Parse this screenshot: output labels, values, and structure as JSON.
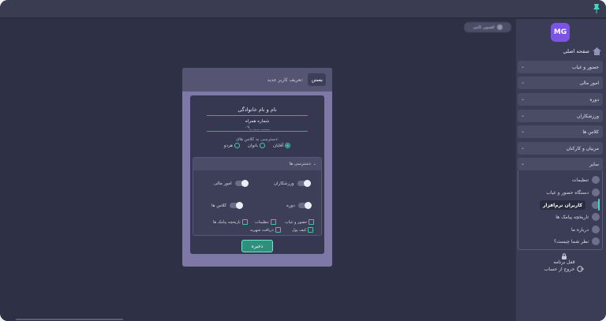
{
  "user_chip": {
    "label": "افسون کاتبی"
  },
  "logo": {
    "text": "MG"
  },
  "sidebar": {
    "home": "صفحه اصلی",
    "menus": [
      {
        "label": "حضور و غیاب"
      },
      {
        "label": "امور مالی"
      },
      {
        "label": "دوره"
      },
      {
        "label": "ورزشکاران"
      },
      {
        "label": "کلاس ها"
      },
      {
        "label": "مربیان و کارکنان"
      },
      {
        "label": "سایر"
      }
    ],
    "sub_items": [
      {
        "label": "تنظیمات",
        "icon": "gear-icon"
      },
      {
        "label": "دستگاه حضور و غیاب",
        "icon": "device-gear-icon"
      },
      {
        "label": "کاربران نرم‌افزار",
        "icon": "users-icon"
      },
      {
        "label": "تاریخچه پیامک ها",
        "icon": "sms-history-icon"
      },
      {
        "label": "درباره ما",
        "icon": "info-icon"
      },
      {
        "label": "نظر شما چیست؟",
        "icon": "feedback-icon"
      }
    ],
    "lock": "قفل برنامه",
    "logout": "خروج از حساب"
  },
  "dialog": {
    "title": "تعریف کاربر جدید:",
    "close": "بستن",
    "fields": {
      "name": "نام و نام خانوادگی",
      "phone_label": "شماره همراه",
      "phone_value": "۰۹_ ___ ____"
    },
    "class_access_label": "دسترسی به کلاس های:",
    "radios": [
      "هردو",
      "بانوان",
      "آقایان"
    ],
    "radio_selected": "آقایان",
    "permissions": {
      "title": "دسترسی ها",
      "toggles": [
        "ورزشکاران",
        "امور مالی",
        "دوره",
        "کلاس ها"
      ],
      "checks": [
        "حضور و غیاب",
        "تنظیمات",
        "تاریخچه پیامک ها",
        "کیف پول",
        "دریافت شهریه"
      ]
    },
    "save": "ذخیره"
  },
  "colors": {
    "accent": "#3fc6a8",
    "logo": "#7b54e6",
    "sidebar": "#3b3d56",
    "background": "#2e3045"
  }
}
